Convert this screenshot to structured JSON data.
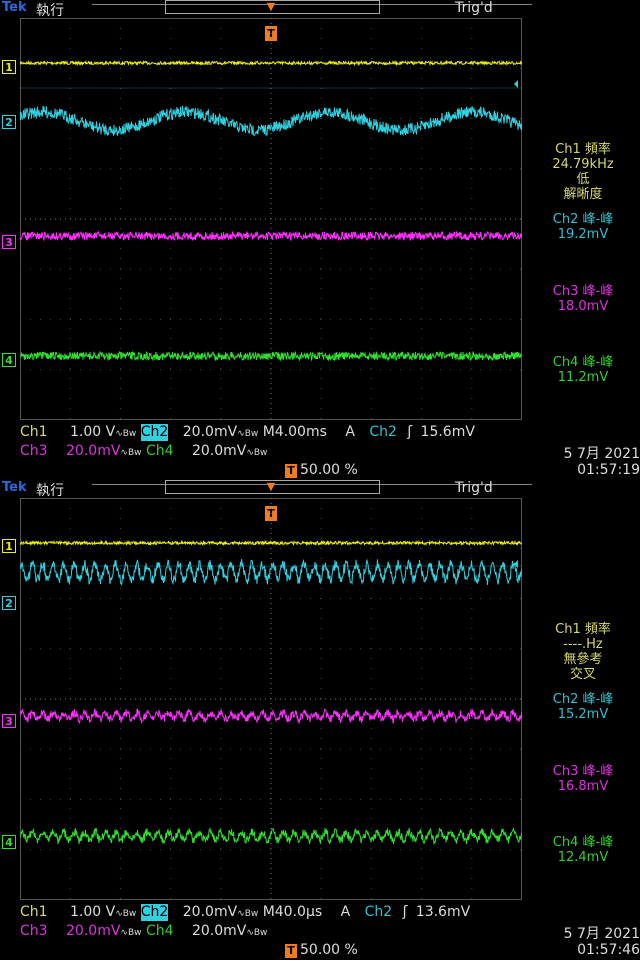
{
  "colors": {
    "ch1": "#f0f000",
    "ch2": "#30d0e0",
    "ch3": "#ff30ff",
    "ch4": "#30e030",
    "trigger": "#f07c1e"
  },
  "screens": [
    {
      "brand": "Tek",
      "mode": "執行",
      "trig_state": "Trig'd",
      "ch_markers": [
        "1",
        "2",
        "3",
        "4"
      ],
      "measurements": [
        {
          "label": "Ch1 頻率",
          "value": "24.79kHz",
          "extra1": "低",
          "extra2": "解晰度"
        },
        {
          "label": "Ch2 峰-峰",
          "value": "19.2mV"
        },
        {
          "label": "Ch3 峰-峰",
          "value": "18.0mV"
        },
        {
          "label": "Ch4 峰-峰",
          "value": "11.2mV"
        }
      ],
      "status": {
        "ch1": "Ch1",
        "ch1_scale": "1.00 V",
        "ch2": "Ch2",
        "ch2_scale": "20.0mV",
        "ch3": "Ch3",
        "ch3_scale": "20.0mV",
        "ch4": "Ch4",
        "ch4_scale": "20.0mV",
        "timebase": "M4.00ms",
        "trig_label": "A",
        "trig_source": "Ch2",
        "trig_level": "15.6mV",
        "trig_pos": "50.00 %",
        "date": "5 7月  2021",
        "time": "01:57:19"
      },
      "ch2_wave": "slow"
    },
    {
      "brand": "Tek",
      "mode": "執行",
      "trig_state": "Trig'd",
      "ch_markers": [
        "1",
        "2",
        "3",
        "4"
      ],
      "measurements": [
        {
          "label": "Ch1 頻率",
          "value": "----.Hz",
          "extra1": "無參考",
          "extra2": "交叉"
        },
        {
          "label": "Ch2 峰-峰",
          "value": "15.2mV"
        },
        {
          "label": "Ch3 峰-峰",
          "value": "16.8mV"
        },
        {
          "label": "Ch4 峰-峰",
          "value": "12.4mV"
        }
      ],
      "status": {
        "ch1": "Ch1",
        "ch1_scale": "1.00 V",
        "ch2": "Ch2",
        "ch2_scale": "20.0mV",
        "ch3": "Ch3",
        "ch3_scale": "20.0mV",
        "ch4": "Ch4",
        "ch4_scale": "20.0mV",
        "timebase": "M40.0µs",
        "trig_label": "A",
        "trig_source": "Ch2",
        "trig_level": "13.6mV",
        "trig_pos": "50.00 %",
        "date": "5 7月  2021",
        "time": "01:57:46"
      },
      "ch2_wave": "fast"
    }
  ]
}
